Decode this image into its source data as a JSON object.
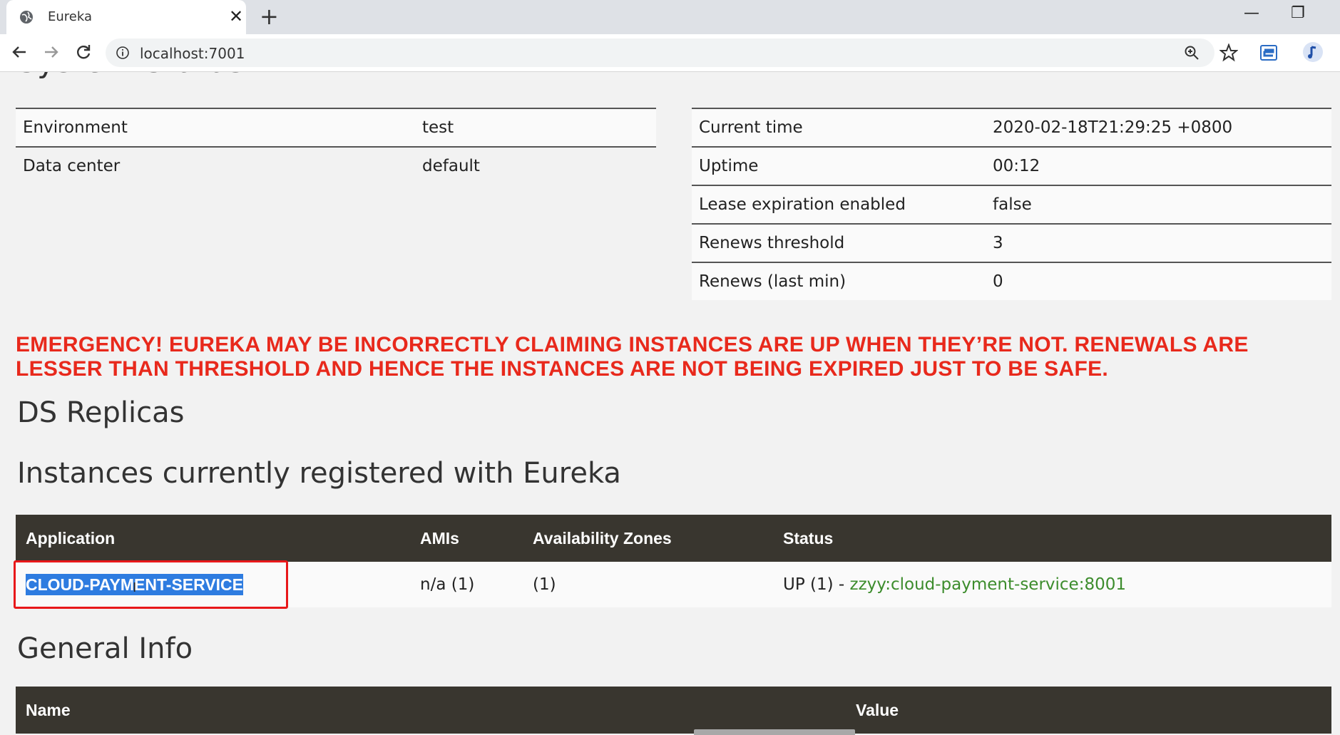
{
  "browser": {
    "tab_title": "Eureka",
    "close_glyph": "✕",
    "newtab_glyph": "+",
    "url": "localhost:7001",
    "minimize_glyph": "—",
    "restore_glyph": "❐"
  },
  "page": {
    "section_title_cut": "System Status",
    "env_table": [
      {
        "key": "Environment",
        "value": "test"
      },
      {
        "key": "Data center",
        "value": "default"
      }
    ],
    "status_table": [
      {
        "key": "Current time",
        "value": "2020-02-18T21:29:25 +0800"
      },
      {
        "key": "Uptime",
        "value": "00:12"
      },
      {
        "key": "Lease expiration enabled",
        "value": "false"
      },
      {
        "key": "Renews threshold",
        "value": "3"
      },
      {
        "key": "Renews (last min)",
        "value": "0"
      }
    ],
    "emergency_line1": "EMERGENCY! EUREKA MAY BE INCORRECTLY CLAIMING INSTANCES ARE UP WHEN THEY’RE NOT. RENEWALS ARE",
    "emergency_line2": "LESSER THAN THRESHOLD AND HENCE THE INSTANCES ARE NOT BEING EXPIRED JUST TO BE SAFE.",
    "replicas_title": "DS Replicas",
    "instances_title": "Instances currently registered with Eureka",
    "instances_headers": {
      "application": "Application",
      "amis": "AMIs",
      "zones": "Availability Zones",
      "status": "Status"
    },
    "instance_row": {
      "application": "CLOUD-PAYMENT-SERVICE",
      "amis": "n/a (1)",
      "zones": "(1)",
      "status_prefix": "UP (1) - ",
      "status_link": "zzyy:cloud-payment-service:8001"
    },
    "general_title": "General Info",
    "general_headers": {
      "name": "Name",
      "value": "Value"
    }
  },
  "colors": {
    "emergency": "#e8291c",
    "table_header": "#39362f",
    "link_green": "#3c8c2c",
    "selection_blue": "#2e7ce0",
    "annotation_red": "#e8181a"
  }
}
